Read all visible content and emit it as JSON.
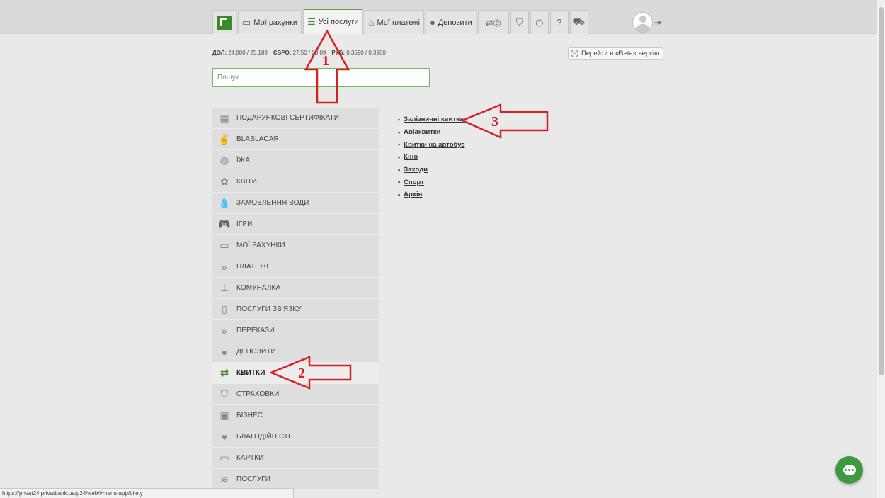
{
  "nav": {
    "accounts_label": "Мої рахунки",
    "all_services_label": "Усі послуги",
    "payments_label": "Мої платежі",
    "deposits_label": "Депозити"
  },
  "rates": {
    "usd_label": "ДОЛ:",
    "usd_value": "24.800 / 25.189",
    "eur_label": "ЄВРО:",
    "eur_value": "27.50 / 28.09",
    "rub_label": "РУБ:",
    "rub_value": "0.3590 / 0.3960"
  },
  "beta": {
    "badge": "24",
    "label": "Перейти в «Beta» версію"
  },
  "search": {
    "placeholder": "Пошук"
  },
  "menu": [
    {
      "label": "ПОДАРУНКОВІ СЕРТИФІКАТИ",
      "icon": "gift-icon"
    },
    {
      "label": "BLABLACAR",
      "icon": "blablacar-icon"
    },
    {
      "label": "ЇЖА",
      "icon": "food-icon"
    },
    {
      "label": "КВІТИ",
      "icon": "flower-icon"
    },
    {
      "label": "ЗАМОВЛЕННЯ ВОДИ",
      "icon": "water-drop-icon"
    },
    {
      "label": "ІГРИ",
      "icon": "gamepad-icon"
    },
    {
      "label": "МОЇ РАХУНКИ",
      "icon": "card-icon"
    },
    {
      "label": "ПЛАТЕЖІ",
      "icon": "double-chevron-icon"
    },
    {
      "label": "КОМУНАЛКА",
      "icon": "faucet-icon"
    },
    {
      "label": "ПОСЛУГИ ЗВ'ЯЗКУ",
      "icon": "phone-icon"
    },
    {
      "label": "ПЕРЕКАЗИ",
      "icon": "double-chevron-icon"
    },
    {
      "label": "ДЕПОЗИТИ",
      "icon": "piggy-bank-icon"
    },
    {
      "label": "КВИТКИ",
      "icon": "tickets-icon",
      "active": true
    },
    {
      "label": "СТРАХОВКИ",
      "icon": "shield-icon"
    },
    {
      "label": "БІЗНЕС",
      "icon": "briefcase-icon"
    },
    {
      "label": "БЛАГОДІЙНІСТЬ",
      "icon": "heart-hands-icon"
    },
    {
      "label": "КАРТКИ",
      "icon": "card-icon"
    },
    {
      "label": "ПОСЛУГИ",
      "icon": "layers-icon"
    }
  ],
  "sublinks": [
    "Залізничні квитки",
    "Авіаквитки",
    "Квитки на автобус",
    "Кіно",
    "Заходи",
    "Спорт",
    "Архів"
  ],
  "annotations": {
    "one": "1",
    "two": "2",
    "three": "3",
    "color": "#d42020"
  },
  "status_url": "https://privat24.privatbank.ua/p24/web/#menu-app/bilety",
  "colors": {
    "brand": "#3b8a2a",
    "accent": "#5a9f3d",
    "chat": "#3d9a40"
  }
}
